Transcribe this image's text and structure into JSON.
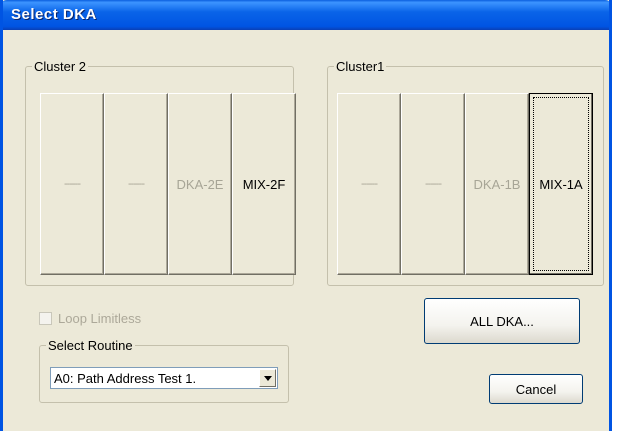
{
  "window": {
    "title": "Select DKA"
  },
  "cluster2": {
    "label": "Cluster 2",
    "buttons": [
      {
        "label": "------",
        "enabled": false
      },
      {
        "label": "------",
        "enabled": false
      },
      {
        "label": "DKA-2E",
        "enabled": false
      },
      {
        "label": "MIX-2F",
        "enabled": true
      }
    ]
  },
  "cluster1": {
    "label": "Cluster1",
    "buttons": [
      {
        "label": "------",
        "enabled": false
      },
      {
        "label": "------",
        "enabled": false
      },
      {
        "label": "DKA-1B",
        "enabled": false
      },
      {
        "label": "MIX-1A",
        "enabled": true,
        "focused": true
      }
    ]
  },
  "loop": {
    "label": "Loop Limitless",
    "checked": false,
    "enabled": false
  },
  "routine": {
    "label": "Select Routine",
    "selected": "A0: Path Address Test 1."
  },
  "buttons": {
    "all_dka": "ALL DKA...",
    "cancel": "Cancel"
  },
  "colors": {
    "title_bar": "#0054e3",
    "dialog_bg": "#ece9d8",
    "disabled_text": "#a7a596"
  }
}
